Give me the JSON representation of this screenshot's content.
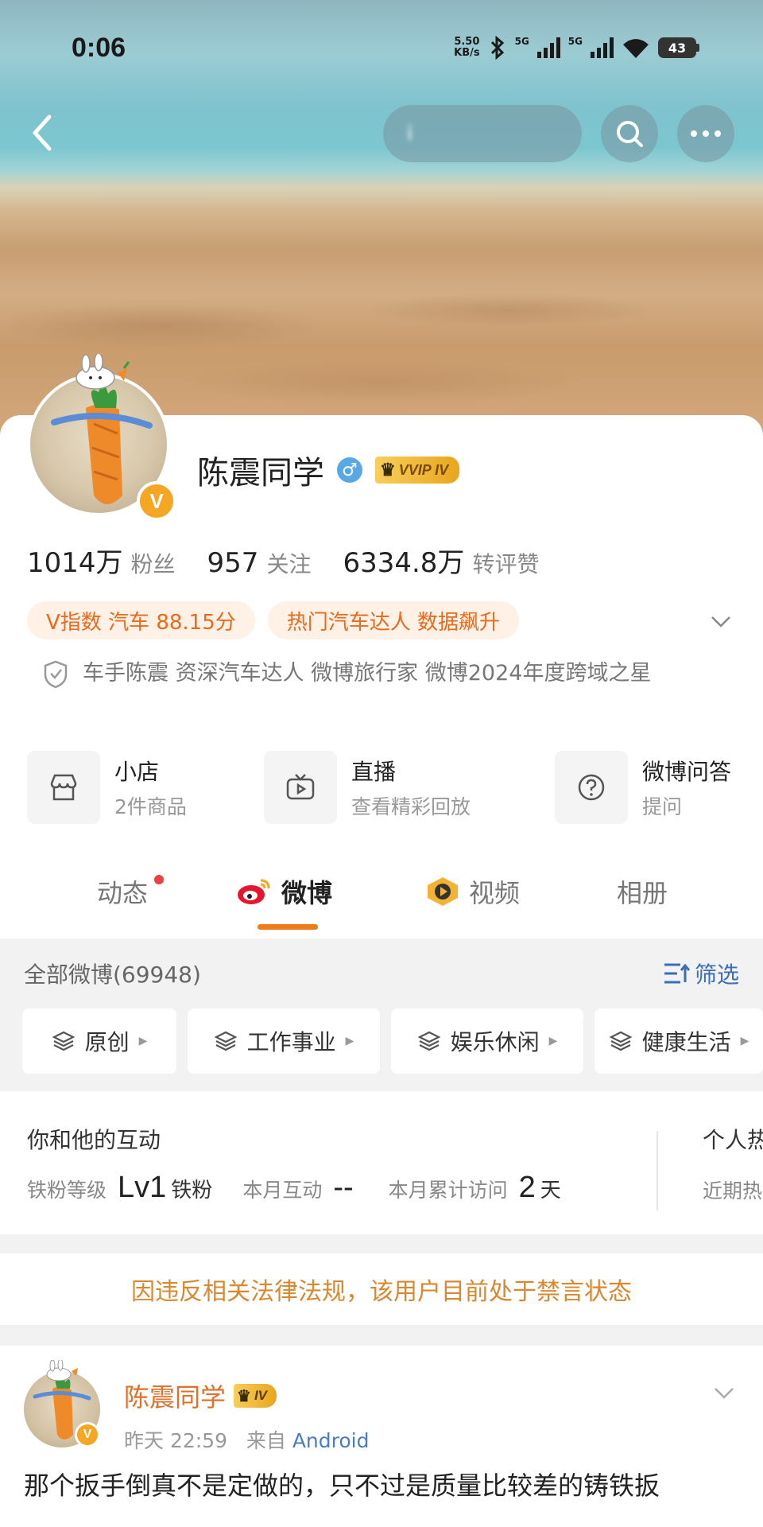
{
  "statusbar": {
    "time": "0:06",
    "net_speed_value": "5.50",
    "net_speed_unit": "KB/s",
    "sim1_label": "5G",
    "sim2_label": "5G",
    "battery": "43"
  },
  "topnav": {
    "search_text": "i"
  },
  "profile": {
    "name": "陈震同学",
    "gender_symbol": "♂",
    "vvip_label": "VVIP IV",
    "badge_letter": "V",
    "stats": [
      {
        "num": "1014万",
        "label": "粉丝"
      },
      {
        "num": "957",
        "label": "关注"
      },
      {
        "num": "6334.8万",
        "label": "转评赞"
      }
    ],
    "tags": [
      "V指数 汽车 88.15分",
      "热门汽车达人 数据飙升"
    ],
    "verify_text": "车手陈震 资深汽车达人 微博旅行家 微博2024年度跨域之星"
  },
  "shortcuts": [
    {
      "title": "小店",
      "sub": "2件商品",
      "icon": "shop-icon"
    },
    {
      "title": "直播",
      "sub": "查看精彩回放",
      "icon": "tv-icon"
    },
    {
      "title": "微博问答",
      "sub": "提问",
      "icon": "question-icon"
    }
  ],
  "tabs": [
    {
      "label": "动态"
    },
    {
      "label": "微博"
    },
    {
      "label": "视频"
    },
    {
      "label": "相册"
    }
  ],
  "filter": {
    "all_label": "全部微博(69948)",
    "filter_label": "筛选",
    "chips": [
      "原创",
      "工作事业",
      "娱乐休闲",
      "健康生活"
    ]
  },
  "interaction": {
    "title": "你和他的互动",
    "fan_level_label": "铁粉等级",
    "fan_level_value": "Lv1",
    "fan_level_unit": "铁粉",
    "month_interact_label": "本月互动",
    "month_interact_value": "--",
    "month_visit_label": "本月累计访问",
    "month_visit_value": "2",
    "month_visit_unit": "天",
    "right_title": "个人热",
    "right_sub": "近期热"
  },
  "banned_notice": "因违反相关法律法规，该用户目前处于禁言状态",
  "post": {
    "name": "陈震同学",
    "level_badge": "IV",
    "time": "昨天 22:59",
    "source_prefix": "来自",
    "source": "Android",
    "text": "那个扳手倒真不是定做的，只不过是质量比较差的铸铁扳"
  },
  "colors": {
    "accent_orange": "#ef7b1a",
    "link_blue": "#3a6fb5",
    "tag_text": "#e96a1d",
    "verified_gold": "#f5a623"
  }
}
